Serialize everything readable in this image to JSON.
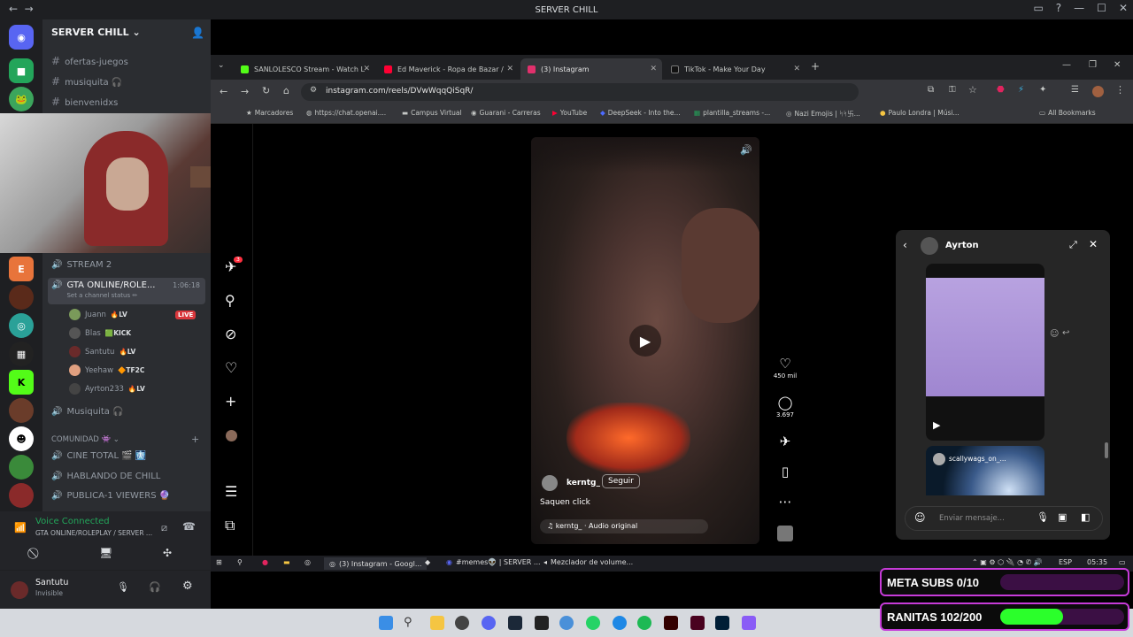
{
  "window": {
    "title": "SERVER CHILL"
  },
  "server": {
    "name": "SERVER CHILL"
  },
  "text_channels": [
    "ofertas-juegos",
    "musiquita 🎧",
    "bienvenidxs"
  ],
  "voice_channels": {
    "stream2": "STREAM 2",
    "gta": "GTA ONLINE/ROLE...",
    "gta_timer": "1:06:18",
    "gta_status": "Set a channel status ✏",
    "musiquita": "Musiquita 🎧"
  },
  "voice_users": [
    {
      "name": "Juann",
      "tag": "LV",
      "live": "LIVE"
    },
    {
      "name": "Blas",
      "tag": "KICK",
      "live": ""
    },
    {
      "name": "Santutu",
      "tag": "LV",
      "live": ""
    },
    {
      "name": "Yeehaw",
      "tag": "TF2C",
      "live": ""
    },
    {
      "name": "Ayrton233",
      "tag": "LV",
      "live": ""
    }
  ],
  "category": {
    "name": "COMUNIDAD 👾 ⌄",
    "plus": "+"
  },
  "community_channels": [
    "CINE TOTAL 🎬 🩻",
    "HABLANDO DE CHILL",
    "PUBLICA-1 VIEWERS 🔮"
  ],
  "voice_connected": {
    "title": "Voice Connected",
    "channel": "GTA ONLINE/ROLEPLAY / SERVER ..."
  },
  "self_user": {
    "name": "Santutu",
    "status": "Invisible"
  },
  "browser": {
    "tabs": [
      {
        "label": "SANLOLESCO Stream - Watch L",
        "color": "#53fc18"
      },
      {
        "label": "Ed Maverick - Ropa de Bazar /",
        "color": "#ff0033"
      },
      {
        "label": "(3) Instagram",
        "color": "#e1306c"
      },
      {
        "label": "TikTok - Make Your Day",
        "color": "#111111"
      }
    ],
    "url": "instagram.com/reels/DVwWqqQiSqR/",
    "bookmarks": [
      "Marcadores",
      "https://chat.openai....",
      "Campus Virtual",
      "Guarani - Carreras",
      "YouTube",
      "DeepSeek - Into the...",
      "plantilla_streams -...",
      "Nazi Emojis | ᛋᛋ卐...",
      "Paulo Londra | Músi...",
      "All Bookmarks"
    ]
  },
  "reel": {
    "username": "kerntg_",
    "follow": "Seguir",
    "caption": "Saquen click",
    "audio": "kerntg_ · Audio original",
    "likes": "450 mil",
    "comments": "3.697",
    "notif_count": "3"
  },
  "dm": {
    "name": "Ayrton",
    "shared_user": "scallywags_on_...",
    "placeholder": "Enviar mensaje..."
  },
  "inner_taskbar": {
    "items": [
      "(3) Instagram - Googl...",
      "#memes👽 | SERVER ...",
      "Mezclador de volume..."
    ],
    "lang": "ESP",
    "time": "05:35"
  },
  "goals": [
    {
      "label": "META SUBS 0/10",
      "progress": 0.0,
      "color": "#7a1f8a"
    },
    {
      "label": "RANITAS 102/200",
      "progress": 0.51,
      "color": "#2bff2b"
    }
  ]
}
